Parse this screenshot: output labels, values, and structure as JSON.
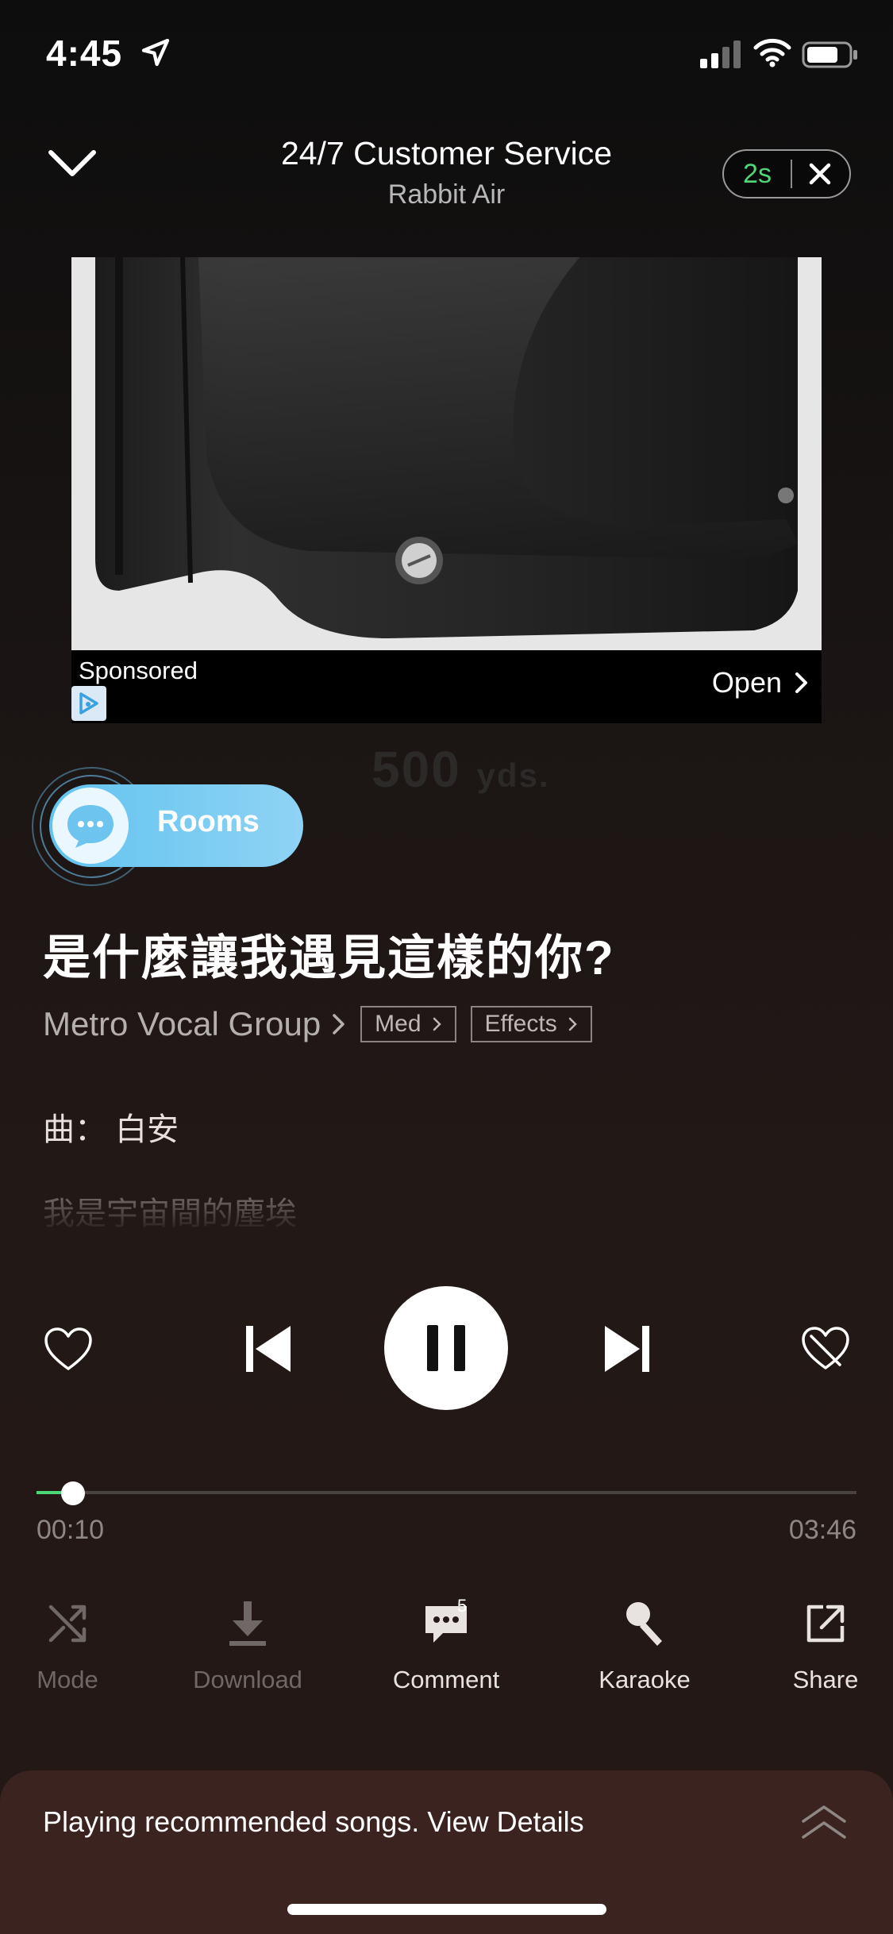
{
  "status_bar": {
    "time": "4:45"
  },
  "ad": {
    "title": "24/7 Customer Service",
    "advertiser": "Rabbit Air",
    "skip_countdown": "2s",
    "sponsored_label": "Sponsored",
    "open_label": "Open",
    "background_text": "500",
    "background_text_unit": "yds."
  },
  "rooms": {
    "label": "Rooms"
  },
  "song": {
    "title": "是什麼讓我遇見這樣的你?",
    "artist": "Metro Vocal Group",
    "tags": [
      "Med",
      "Effects"
    ]
  },
  "lyrics": {
    "line1": "曲： 白安",
    "line2": "我是宇宙間的塵埃"
  },
  "progress": {
    "current": "00:10",
    "total": "03:46",
    "fraction": 0.045
  },
  "actions": {
    "mode": "Mode",
    "download": "Download",
    "comment": "Comment",
    "comment_count": "5",
    "karaoke": "Karaoke",
    "share": "Share"
  },
  "recommendation": {
    "text": "Playing recommended songs. View Details"
  },
  "colors": {
    "accent": "#4fd676",
    "rooms": "#61c3f0",
    "rec_bar": "#3b2420"
  }
}
